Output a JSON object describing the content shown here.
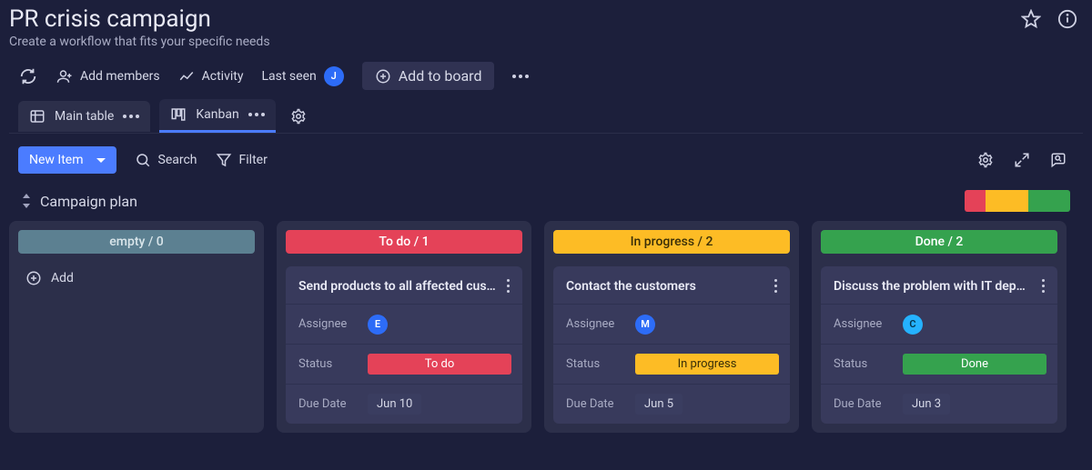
{
  "header": {
    "title": "PR crisis campaign",
    "subtitle": "Create a workflow that fits your specific needs"
  },
  "toolbar": {
    "add_members": "Add members",
    "activity": "Activity",
    "last_seen": "Last seen",
    "last_seen_avatar": "J",
    "add_to_board": "Add to board"
  },
  "views": {
    "main_table": "Main table",
    "kanban": "Kanban"
  },
  "controls": {
    "new_item": "New Item",
    "search": "Search",
    "filter": "Filter"
  },
  "group": {
    "name": "Campaign plan",
    "progress": {
      "red_pct": 20,
      "yellow_pct": 40,
      "green_pct": 40
    }
  },
  "columns": [
    {
      "class": "ch-empty",
      "header": "empty / 0",
      "add_label": "Add",
      "cards": []
    },
    {
      "class": "ch-red",
      "header": "To do / 1",
      "cards": [
        {
          "title": "Send products to all affected cust…",
          "assignee_letter": "E",
          "assignee_class": "av-blue",
          "status_label": "To do",
          "status_class": "badge-red",
          "due": "Jun 10"
        }
      ]
    },
    {
      "class": "ch-yellow",
      "header": "In progress / 2",
      "cards": [
        {
          "title": "Contact the customers",
          "assignee_letter": "M",
          "assignee_class": "av-blue",
          "status_label": "In progress",
          "status_class": "badge-yellow",
          "due": "Jun 5"
        }
      ]
    },
    {
      "class": "ch-green",
      "header": "Done / 2",
      "cards": [
        {
          "title": "Discuss the problem with IT depar…",
          "assignee_letter": "C",
          "assignee_class": "av-cyan",
          "status_label": "Done",
          "status_class": "badge-green",
          "due": "Jun 3"
        }
      ]
    }
  ],
  "field_labels": {
    "assignee": "Assignee",
    "status": "Status",
    "due": "Due Date"
  }
}
